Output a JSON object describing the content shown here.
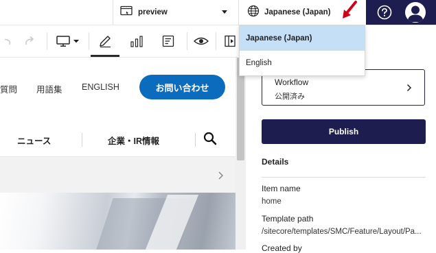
{
  "topbar": {
    "device_label": "preview",
    "language_label": "Japanese (Japan)",
    "help_icon": "help-circle-icon",
    "avatar_icon": "user-avatar-icon"
  },
  "language_dropdown": {
    "options": [
      "Japanese (Japan)",
      "English"
    ],
    "selected": "Japanese (Japan)"
  },
  "toolbar": {
    "icons": [
      "undo-icon",
      "redo-icon",
      "desktop-device-icon",
      "pencil-edit-icon",
      "analytics-chart-icon",
      "form-icon",
      "preview-eye-icon",
      "panel-toggle-icon"
    ],
    "active": "pencil-edit-icon"
  },
  "site": {
    "nav_top": [
      "質問",
      "用語集",
      "ENGLISH"
    ],
    "contact_label": "お問い合わせ",
    "nav_main": [
      "ニュース",
      "企業・IR情報"
    ]
  },
  "panel": {
    "workflow_title": "Workflow",
    "workflow_status": "公開済み",
    "publish_label": "Publish",
    "details_title": "Details",
    "item_name_label": "Item name",
    "item_name_value": "home",
    "template_path_label": "Template path",
    "template_path_value": "/sitecore/templates/SMC/Feature/Layout/Pa...",
    "created_by_label": "Created by"
  },
  "colors": {
    "navy": "#1d1d4f",
    "contact_blue": "#0b6bbd",
    "selected_option_bg": "#c5dff6",
    "annotation_arrow": "#d0021b"
  }
}
